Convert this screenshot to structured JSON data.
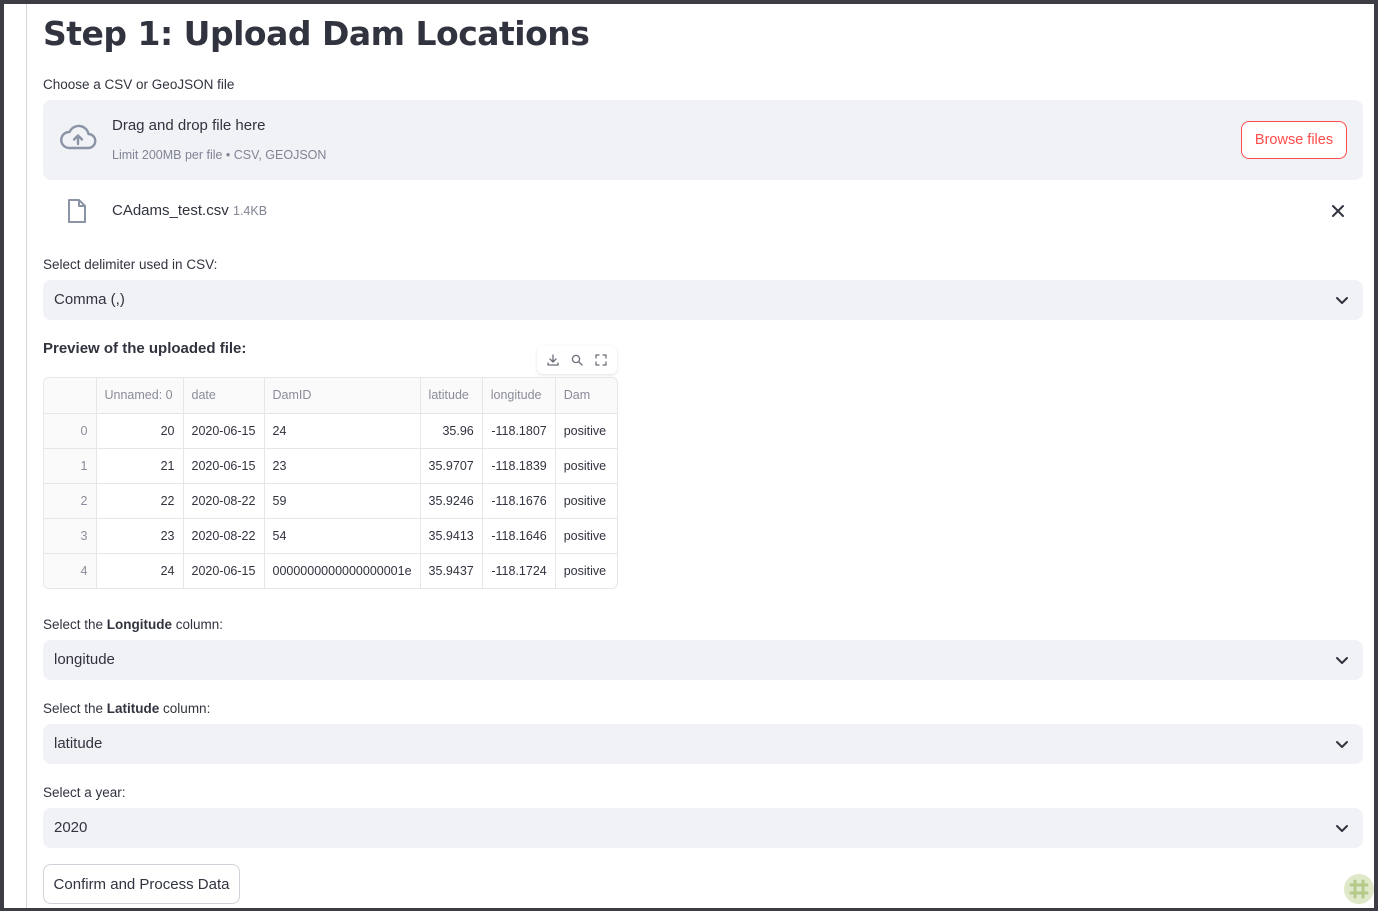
{
  "page": {
    "title": "Step 1: Upload Dam Locations"
  },
  "upload": {
    "label": "Choose a CSV or GeoJSON file",
    "drag_text": "Drag and drop file here",
    "limit_text": "Limit 200MB per file • CSV, GEOJSON",
    "browse_label": "Browse files",
    "icon": "cloud-upload-icon"
  },
  "uploaded_file": {
    "name": "CAdams_test.csv",
    "size": "1.4KB",
    "icon": "file-icon",
    "remove_icon": "close-icon"
  },
  "delimiter": {
    "label": "Select delimiter used in CSV:",
    "value": "Comma (,)"
  },
  "preview": {
    "title": "Preview of the uploaded file:",
    "toolbar": [
      "download-icon",
      "search-icon",
      "fullscreen-icon"
    ],
    "columns": [
      "",
      "Unnamed: 0",
      "date",
      "DamID",
      "latitude",
      "longitude",
      "Dam"
    ],
    "rows": [
      [
        "0",
        "20",
        "2020-06-15",
        "24",
        "35.96",
        "-118.1807",
        "positive"
      ],
      [
        "1",
        "21",
        "2020-06-15",
        "23",
        "35.9707",
        "-118.1839",
        "positive"
      ],
      [
        "2",
        "22",
        "2020-08-22",
        "59",
        "35.9246",
        "-118.1676",
        "positive"
      ],
      [
        "3",
        "23",
        "2020-08-22",
        "54",
        "35.9413",
        "-118.1646",
        "positive"
      ],
      [
        "4",
        "24",
        "2020-06-15",
        "0000000000000000001e",
        "35.9437",
        "-118.1724",
        "positive"
      ]
    ]
  },
  "longitude_select": {
    "label_pre": "Select the ",
    "label_bold": "Longitude",
    "label_post": " column:",
    "value": "longitude"
  },
  "latitude_select": {
    "label_pre": "Select the ",
    "label_bold": "Latitude",
    "label_post": " column:",
    "value": "latitude"
  },
  "year_select": {
    "label": "Select a year:",
    "value": "2020"
  },
  "confirm_label": "Confirm and Process Data",
  "colors": {
    "accent": "#ff4b4b",
    "input_bg": "#f0f2f6",
    "text": "#31333f",
    "muted": "#808495"
  }
}
